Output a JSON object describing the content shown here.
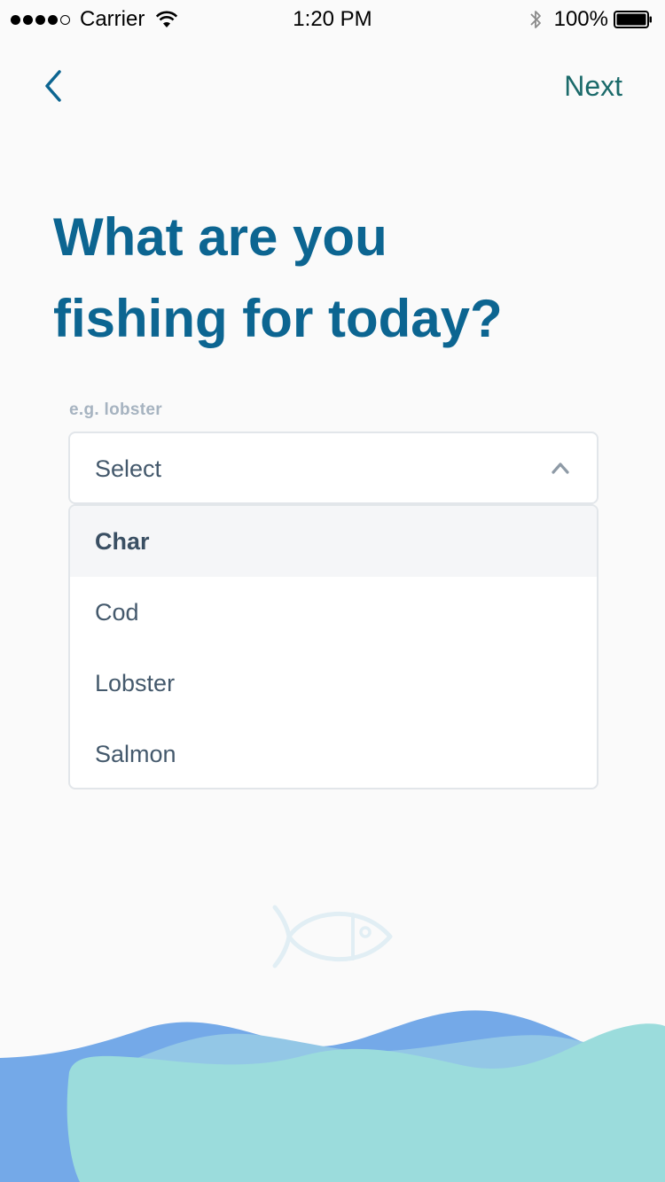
{
  "status_bar": {
    "carrier": "Carrier",
    "time": "1:20 PM",
    "battery": "100%"
  },
  "nav": {
    "back_icon": "chevron-left-icon",
    "next_label": "Next"
  },
  "title": {
    "line1": "What are you",
    "line2": "fishing for today?"
  },
  "dropdown": {
    "hint": "e.g. lobster",
    "value": "Select",
    "toggle_icon": "chevron-up-icon",
    "options": [
      {
        "label": "Char",
        "highlighted": true
      },
      {
        "label": "Cod"
      },
      {
        "label": "Lobster"
      },
      {
        "label": "Salmon"
      }
    ]
  },
  "colors": {
    "accent": "#0c6591",
    "next_text": "#1b6a6a",
    "wave_blue": "#74a9e8",
    "wave_light_blue": "#93c7e6",
    "wave_teal": "#9bdcdc"
  }
}
